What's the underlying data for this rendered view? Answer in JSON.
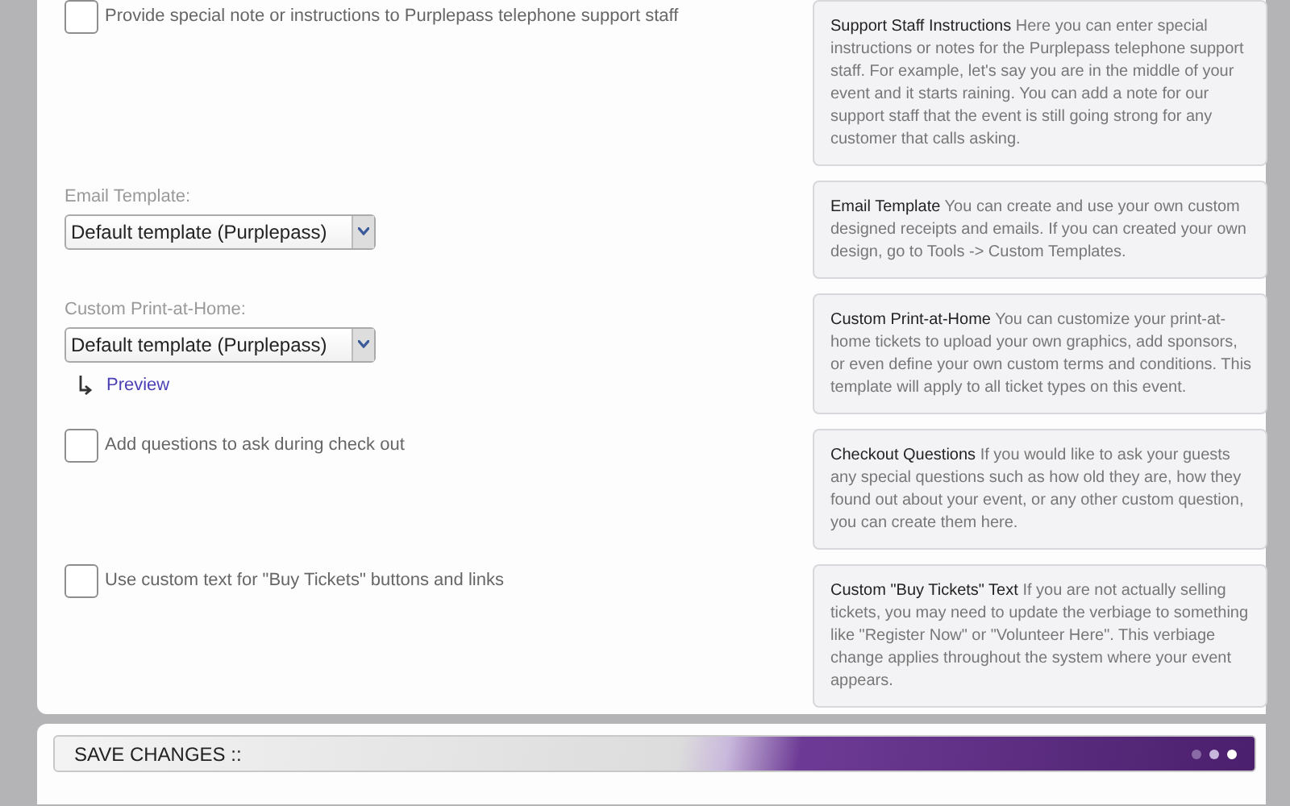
{
  "settings": [
    {
      "kind": "checkbox",
      "label": "Provide special note or instructions to Purplepass telephone support staff",
      "checked": false,
      "help_title": "Support Staff Instructions",
      "help_text": "Here you can enter special instructions or notes for the Purplepass telephone support staff. For example, let's say you are in the middle of your event and it starts raining. You can add a note for our support staff that the event is still going strong for any customer that calls asking."
    },
    {
      "kind": "select",
      "label": "Email Template:",
      "value": "Default template (Purplepass)",
      "help_title": "Email Template",
      "help_text": "You can create and use your own custom designed receipts and emails. If you can created your own design, go to Tools -> Custom Templates."
    },
    {
      "kind": "select",
      "label": "Custom Print-at-Home:",
      "value": "Default template (Purplepass)",
      "link": "Preview",
      "help_title": "Custom Print-at-Home",
      "help_text": "You can customize your print-at-home tickets to upload your own graphics, add sponsors, or even define your own custom terms and conditions. This template will apply to all ticket types on this event."
    },
    {
      "kind": "checkbox",
      "label": "Add questions to ask during check out",
      "checked": false,
      "help_title": "Checkout Questions",
      "help_text": "If you would like to ask your guests any special questions such as how old they are, how they found out about your event, or any other custom question, you can create them here."
    },
    {
      "kind": "checkbox",
      "label": "Use custom text for \"Buy Tickets\" buttons and links",
      "checked": false,
      "help_title": "Custom \"Buy Tickets\" Text",
      "help_text": "If you are not actually selling tickets, you may need to update the verbiage to something like \"Register Now\" or \"Volunteer Here\". This verbiage change applies throughout the system where your event appears."
    }
  ],
  "save_bar": {
    "title": "SAVE CHANGES ::"
  }
}
